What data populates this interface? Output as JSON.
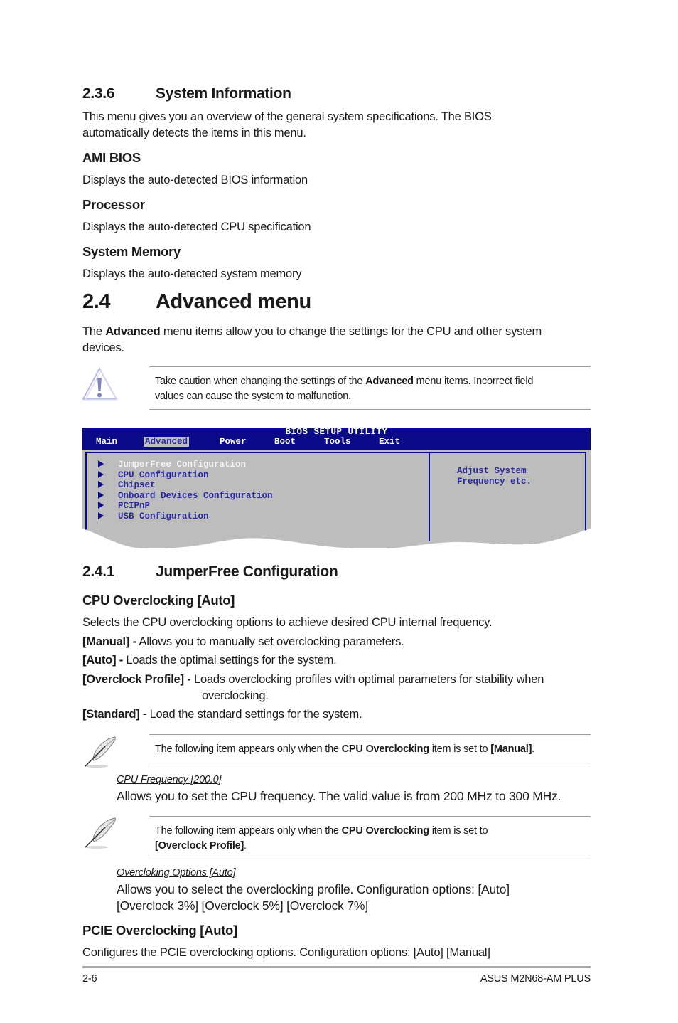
{
  "sec236": {
    "num": "2.3.6",
    "title": "System Information",
    "intro_l1": "This menu gives you an overview of the general system specifications. The BIOS",
    "intro_l2": "automatically detects the items in this menu.",
    "items": [
      {
        "heading": "AMI BIOS",
        "desc": "Displays the auto-detected BIOS information"
      },
      {
        "heading": "Processor",
        "desc": "Displays the auto-detected CPU specification"
      },
      {
        "heading": "System Memory",
        "desc": "Displays the auto-detected system memory"
      }
    ]
  },
  "sec24": {
    "num": "2.4",
    "title": "Advanced menu",
    "intro_pre": "The ",
    "intro_bold": "Advanced",
    "intro_post": " menu items allow you to change the settings for the CPU and other system",
    "intro_l2": "devices.",
    "caution": {
      "icon": "warning-icon",
      "pre": "Take caution when changing the settings of the ",
      "bold": "Advanced",
      "post": " menu items. Incorrect field",
      "l2": "values can cause the system to malfunction."
    }
  },
  "bios": {
    "title": "BIOS SETUP UTILITY",
    "tabs": [
      "Main",
      "Advanced",
      "Power",
      "Boot",
      "Tools",
      "Exit"
    ],
    "active_tab": "Advanced",
    "items": [
      "JumperFree Configuration",
      "CPU Configuration",
      "Chipset",
      "Onboard Devices Configuration",
      "PCIPnP",
      "USB Configuration"
    ],
    "selected_item": "JumperFree Configuration",
    "help_l1": "Adjust System",
    "help_l2": "Frequency etc.",
    "colors": {
      "frame": "#0b0b8a",
      "background": "#bdbdbd",
      "text": "#2a2aa0"
    }
  },
  "sec241": {
    "num": "2.4.1",
    "title": "JumperFree Configuration",
    "cpu_oc": {
      "heading": "CPU Overclocking [Auto]",
      "desc": "Selects the CPU overclocking options to achieve desired CPU internal frequency.",
      "options": [
        {
          "label": "[Manual] -",
          "text": " Allows you to manually set overclocking parameters."
        },
        {
          "label": "[Auto] -",
          "text": " Loads the optimal settings for the system."
        },
        {
          "label": "[Overclock Profile] -",
          "text": " Loads overclocking profiles with optimal parameters for stability when",
          "text_l2": "overclocking."
        },
        {
          "label": "[Standard]",
          "text": " - Load the standard settings for the system."
        }
      ]
    },
    "note1": {
      "icon": "note-feather-icon",
      "pre": "The following item appears only when the ",
      "bold": "CPU Overclocking",
      "mid": " item is set to ",
      "bold2": "[Manual]",
      "post": "."
    },
    "cpu_freq": {
      "heading": "CPU Frequency [200.0]",
      "desc": "Allows you to set the CPU frequency. The valid value is from 200 MHz to 300 MHz."
    },
    "note2": {
      "icon": "note-feather-icon",
      "pre": "The following item appears only when the ",
      "bold": "CPU Overclocking",
      "mid": " item is set to",
      "bold2": "[Overclock Profile]",
      "post": "."
    },
    "oc_options": {
      "heading": "Overcloking Options [Auto]",
      "desc_l1": "Allows you to select the overclocking profile. Configuration options: [Auto]",
      "desc_l2": "[Overclock 3%] [Overclock 5%] [Overclock 7%]"
    },
    "pcie_oc": {
      "heading": "PCIE Overclocking [Auto]",
      "desc": "Configures the PCIE overclocking options. Configuration options: [Auto] [Manual]"
    }
  },
  "footer": {
    "page": "2-6",
    "product": "ASUS M2N68-AM PLUS"
  }
}
